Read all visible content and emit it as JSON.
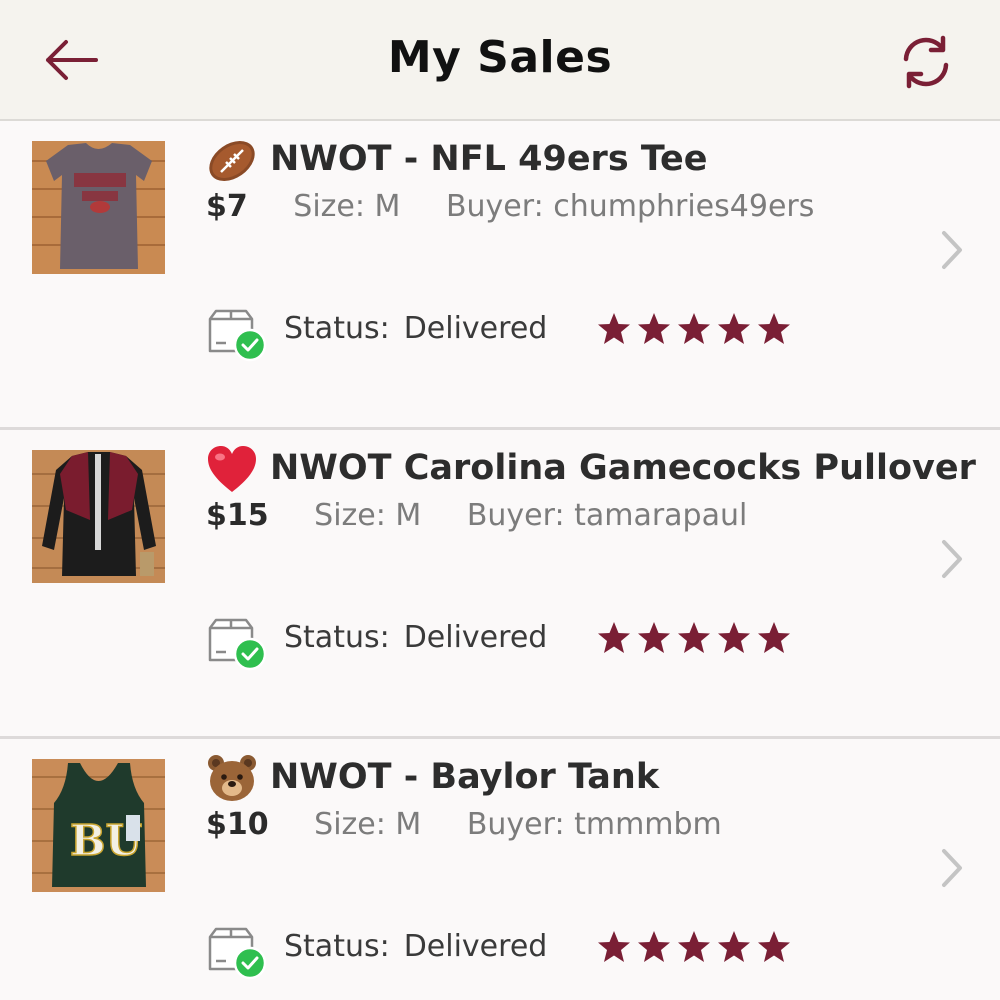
{
  "header": {
    "title": "My Sales",
    "back_icon": "arrow-left-icon",
    "refresh_icon": "refresh-icon"
  },
  "colors": {
    "accent": "#7a1f35",
    "status_check": "#2fbf4f",
    "header_bg": "#f5f3ee"
  },
  "sales": [
    {
      "emoji": "football-emoji",
      "title": "NWOT - NFL 49ers Tee",
      "price": "$7",
      "size": "Size: M",
      "buyer": "Buyer: chumphries49ers",
      "status_label": "Status:",
      "status_value": "Delivered",
      "rating": 5
    },
    {
      "emoji": "red-heart-emoji",
      "title": "NWOT Carolina Gamecocks Pullover",
      "price": "$15",
      "size": "Size: M",
      "buyer": "Buyer: tamarapaul",
      "status_label": "Status:",
      "status_value": "Delivered",
      "rating": 5
    },
    {
      "emoji": "bear-face-emoji",
      "title": "NWOT - Baylor Tank",
      "price": "$10",
      "size": "Size: M",
      "buyer": "Buyer: tmmmbm",
      "status_label": "Status:",
      "status_value": "Delivered",
      "rating": 5
    }
  ]
}
